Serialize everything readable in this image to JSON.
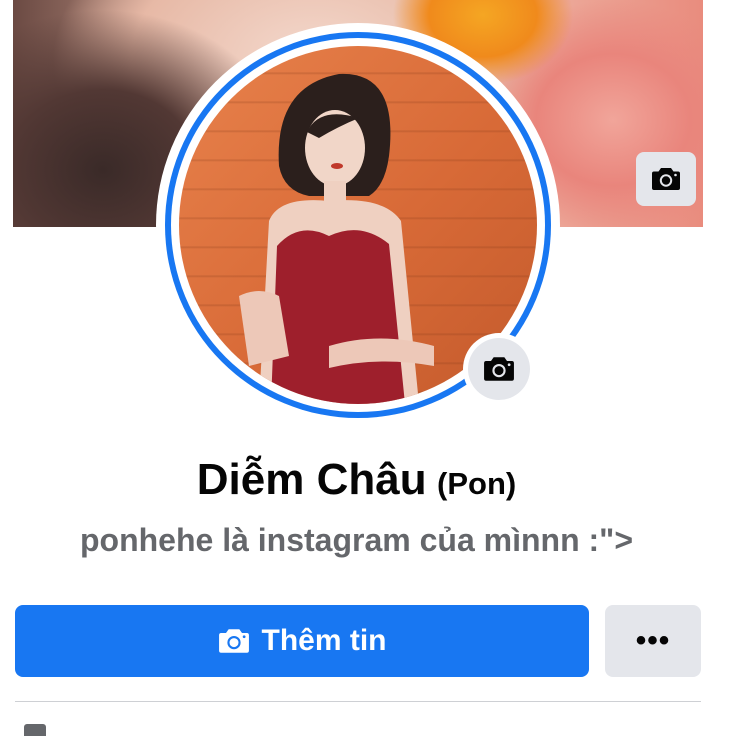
{
  "profile": {
    "name": "Diễm Châu",
    "alternate_name": "(Pon)",
    "bio": "ponhehe là instagram của mìnnn :\">"
  },
  "actions": {
    "add_story_label": "Thêm tin",
    "more_label": "•••"
  },
  "icons": {
    "cover_camera": "camera-icon",
    "avatar_camera": "camera-icon",
    "add_story": "camera-icon"
  },
  "colors": {
    "primary": "#1877f2",
    "secondary_button": "#e4e6eb",
    "text_primary": "#050505",
    "text_secondary": "#65676b"
  }
}
